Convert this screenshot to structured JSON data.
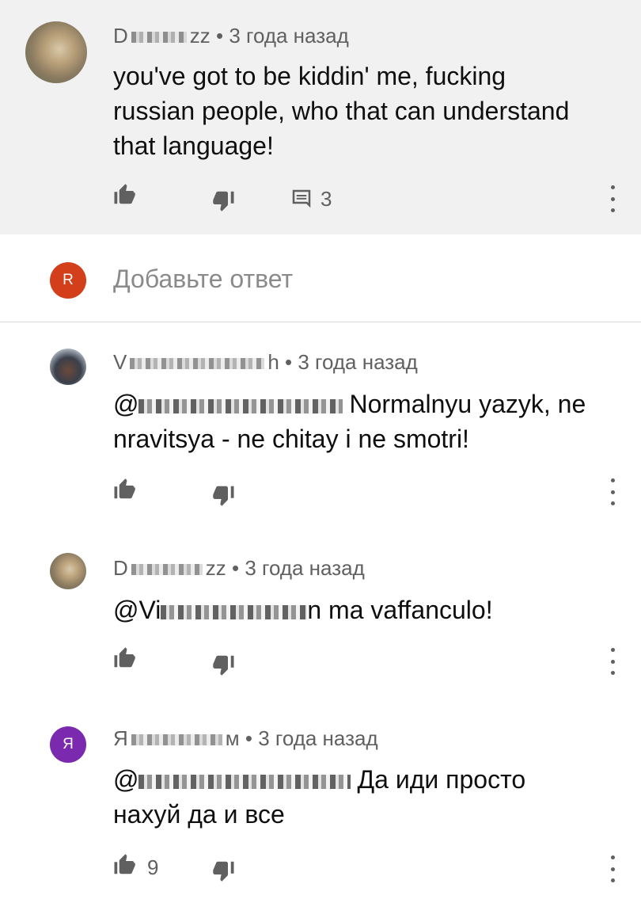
{
  "parent": {
    "author": "D",
    "author_tail": "zz",
    "time": "• 3 года назад",
    "text": "you've got to be kiddin' me, fucking russian people, who that can understand that language!",
    "reply_count": "3"
  },
  "reply_box": {
    "avatar_letter": "R",
    "avatar_color": "#d33f1a",
    "placeholder": "Добавьте ответ"
  },
  "replies": [
    {
      "author_start": "V",
      "author_end": "h",
      "time": "• 3 года назад",
      "mention_start": "@",
      "text": "Normalnyu yazyk, ne nravitsya - ne chitay i ne smotri!",
      "likes": ""
    },
    {
      "author_start": "D",
      "author_end": "zz",
      "time": "• 3 года назад",
      "mention_start": "@Vi",
      "mention_end": "n",
      "text": "ma vaffanculo!",
      "likes": ""
    },
    {
      "author_start": "Я",
      "author_end": "м",
      "time": "• 3 года назад",
      "avatar_letter": "Я",
      "avatar_color": "#7b2ab0",
      "mention_start": "@",
      "text": "Да иди просто нахуй да и все",
      "likes": "9"
    }
  ]
}
